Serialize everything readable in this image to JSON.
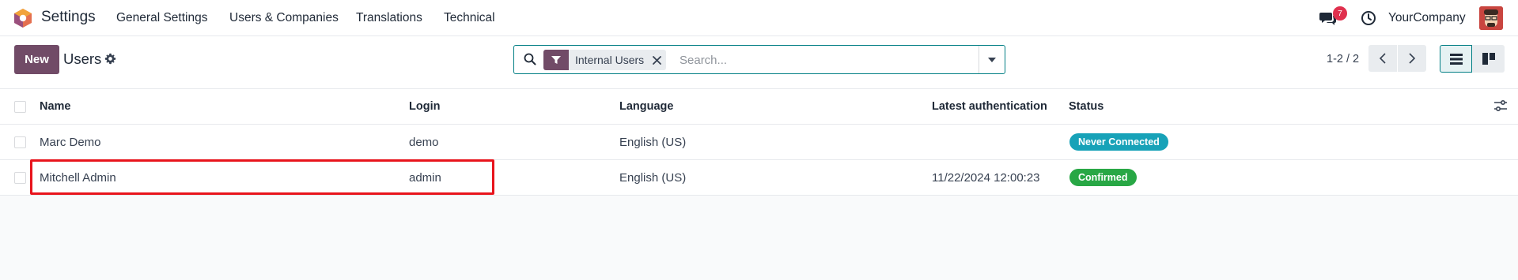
{
  "navbar": {
    "app_name": "Settings",
    "menu": [
      {
        "label": "General Settings"
      },
      {
        "label": "Users & Companies"
      },
      {
        "label": "Translations"
      },
      {
        "label": "Technical"
      }
    ],
    "messages_count": "7",
    "company": "YourCompany"
  },
  "control_panel": {
    "new_label": "New",
    "breadcrumb": "Users",
    "search": {
      "facet_label": "Internal Users",
      "placeholder": "Search..."
    },
    "pager": "1-2 / 2"
  },
  "table": {
    "headers": {
      "name": "Name",
      "login": "Login",
      "language": "Language",
      "latest_auth": "Latest authentication",
      "status": "Status"
    },
    "rows": [
      {
        "name": "Marc Demo",
        "login": "demo",
        "language": "English (US)",
        "latest_auth": "",
        "status": "Never Connected",
        "status_color": "#17a2b8"
      },
      {
        "name": "Mitchell Admin",
        "login": "admin",
        "language": "English (US)",
        "latest_auth": "11/22/2024 12:00:23",
        "status": "Confirmed",
        "status_color": "#28a745"
      }
    ]
  },
  "colors": {
    "brand": "#714b67",
    "accent": "#017e84",
    "highlight": "#e8141c"
  }
}
